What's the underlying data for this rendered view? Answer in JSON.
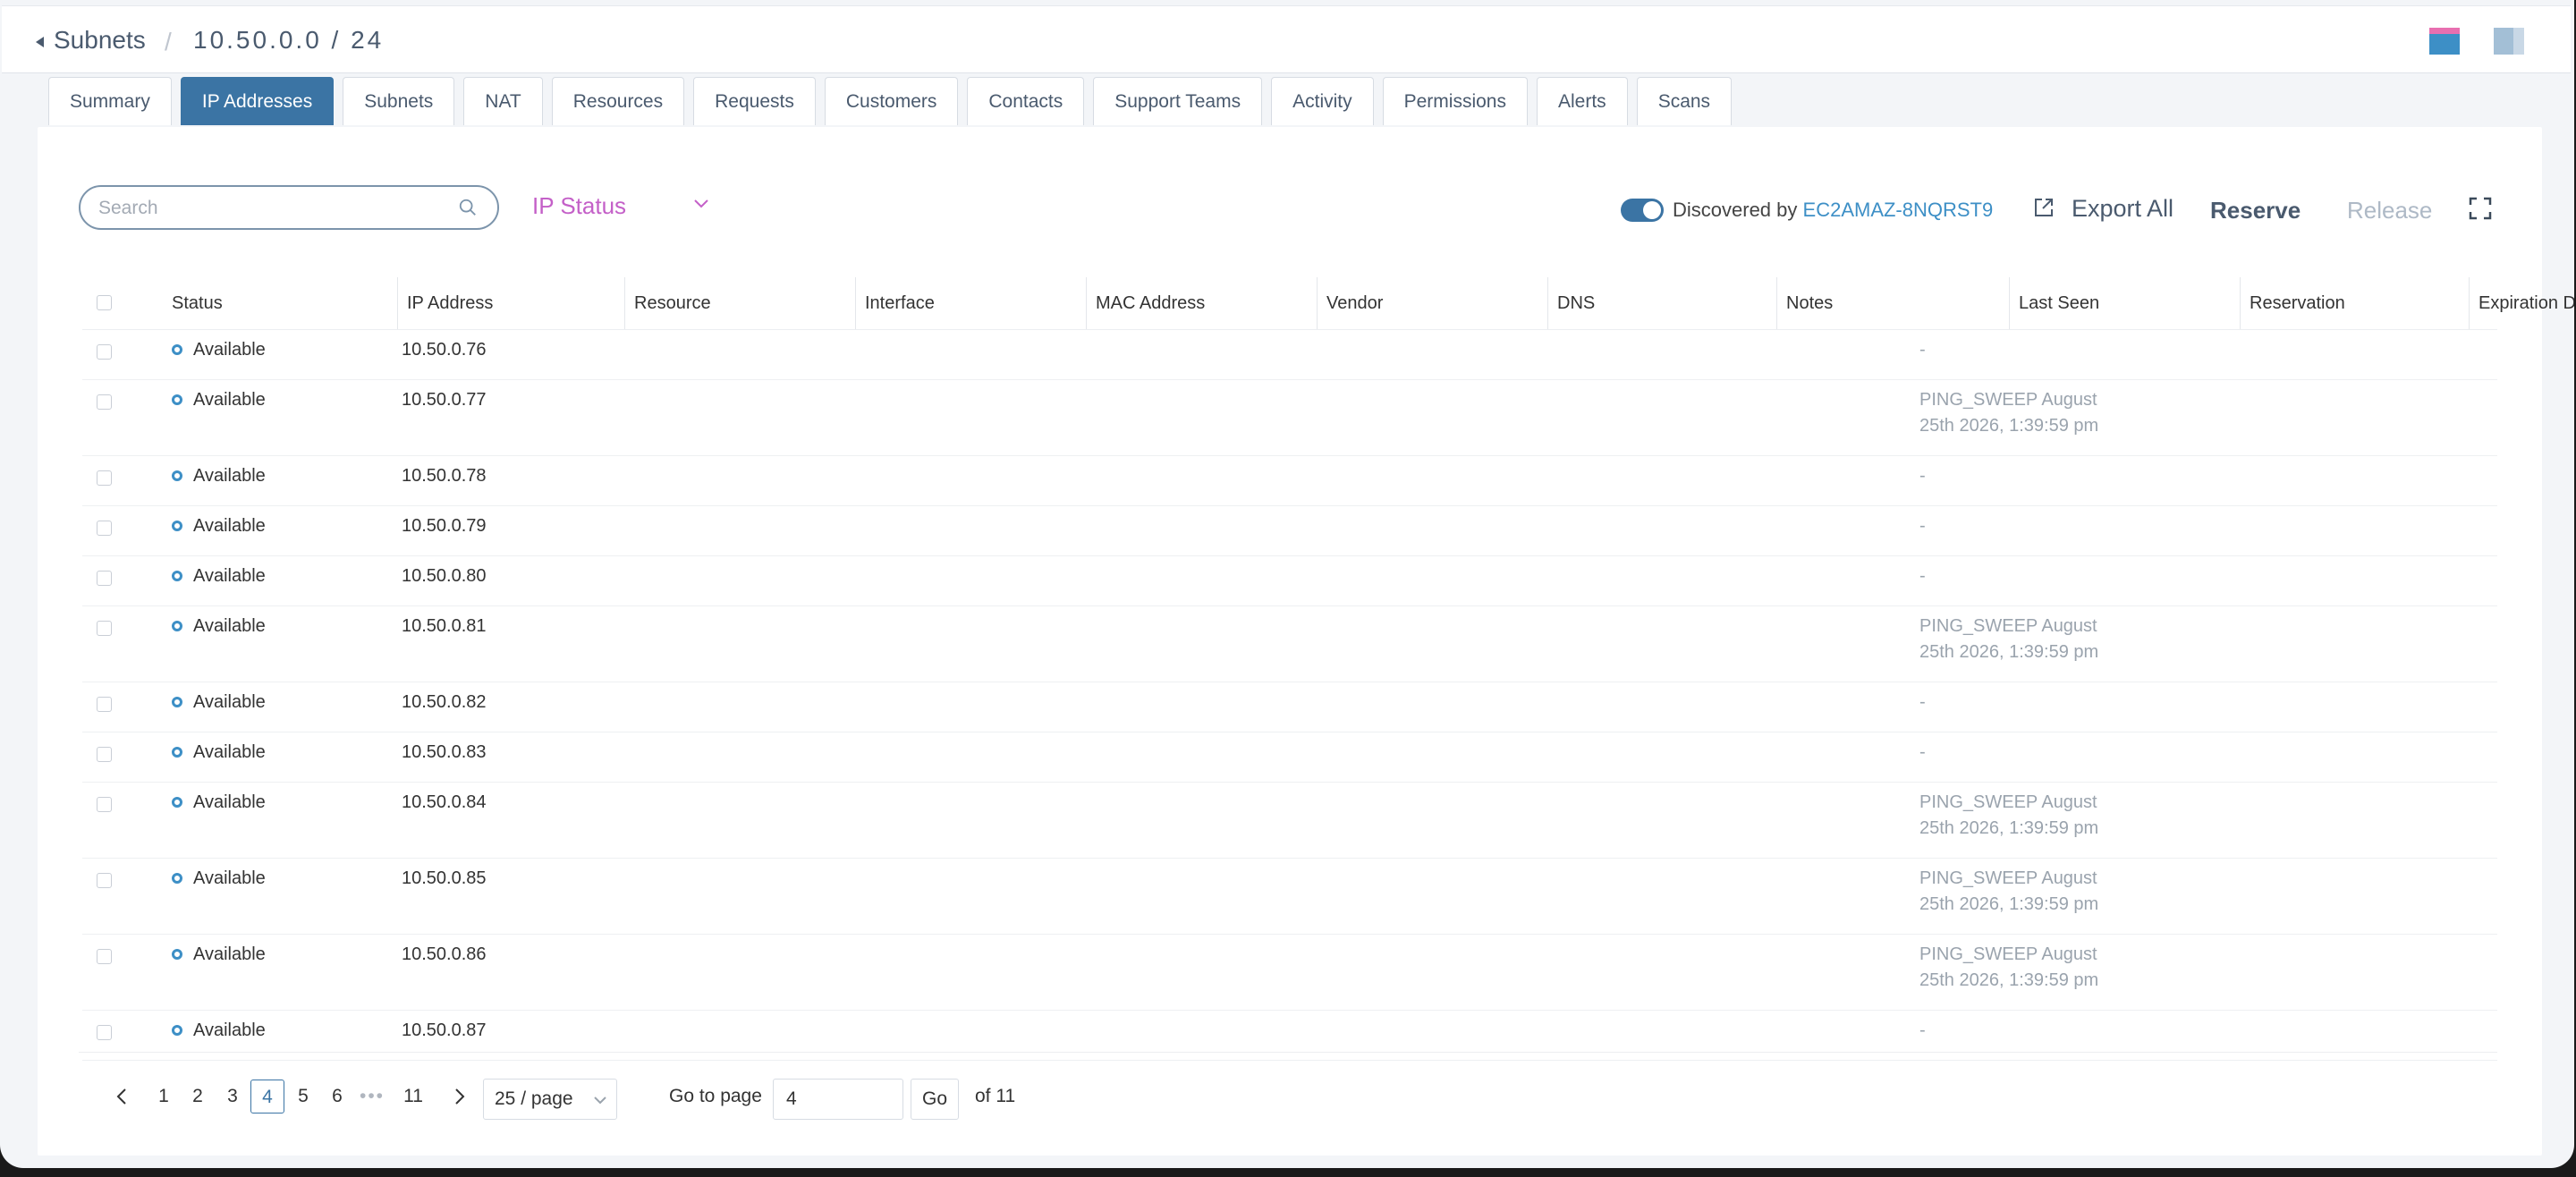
{
  "breadcrumb": {
    "parent": "Subnets",
    "separator": "/",
    "current": "10.50.0.0 / 24"
  },
  "tabs": [
    {
      "label": "Summary",
      "active": false
    },
    {
      "label": "IP Addresses",
      "active": true
    },
    {
      "label": "Subnets",
      "active": false
    },
    {
      "label": "NAT",
      "active": false
    },
    {
      "label": "Resources",
      "active": false
    },
    {
      "label": "Requests",
      "active": false
    },
    {
      "label": "Customers",
      "active": false
    },
    {
      "label": "Contacts",
      "active": false
    },
    {
      "label": "Support Teams",
      "active": false
    },
    {
      "label": "Activity",
      "active": false
    },
    {
      "label": "Permissions",
      "active": false
    },
    {
      "label": "Alerts",
      "active": false
    },
    {
      "label": "Scans",
      "active": false
    }
  ],
  "toolbar": {
    "search_placeholder": "Search",
    "status_filter_label": "IP Status",
    "discovered_label": "Discovered by",
    "discovered_host": "EC2AMAZ-8NQRST9",
    "discovered_enabled": true,
    "export_label": "Export All",
    "reserve_label": "Reserve",
    "release_label": "Release"
  },
  "columns": [
    "Status",
    "IP Address",
    "Resource",
    "Interface",
    "MAC Address",
    "Vendor",
    "DNS",
    "Notes",
    "Last Seen",
    "Reservation",
    "Expiration Date"
  ],
  "rows": [
    {
      "status": "Available",
      "ip": "10.50.0.76",
      "last_seen_1": "-",
      "last_seen_2": ""
    },
    {
      "status": "Available",
      "ip": "10.50.0.77",
      "last_seen_1": "PING_SWEEP August",
      "last_seen_2": "25th 2026, 1:39:59 pm"
    },
    {
      "status": "Available",
      "ip": "10.50.0.78",
      "last_seen_1": "-",
      "last_seen_2": ""
    },
    {
      "status": "Available",
      "ip": "10.50.0.79",
      "last_seen_1": "-",
      "last_seen_2": ""
    },
    {
      "status": "Available",
      "ip": "10.50.0.80",
      "last_seen_1": "-",
      "last_seen_2": ""
    },
    {
      "status": "Available",
      "ip": "10.50.0.81",
      "last_seen_1": "PING_SWEEP August",
      "last_seen_2": "25th 2026, 1:39:59 pm"
    },
    {
      "status": "Available",
      "ip": "10.50.0.82",
      "last_seen_1": "-",
      "last_seen_2": ""
    },
    {
      "status": "Available",
      "ip": "10.50.0.83",
      "last_seen_1": "-",
      "last_seen_2": ""
    },
    {
      "status": "Available",
      "ip": "10.50.0.84",
      "last_seen_1": "PING_SWEEP August",
      "last_seen_2": "25th 2026, 1:39:59 pm"
    },
    {
      "status": "Available",
      "ip": "10.50.0.85",
      "last_seen_1": "PING_SWEEP August",
      "last_seen_2": "25th 2026, 1:39:59 pm"
    },
    {
      "status": "Available",
      "ip": "10.50.0.86",
      "last_seen_1": "PING_SWEEP August",
      "last_seen_2": "25th 2026, 1:39:59 pm"
    },
    {
      "status": "Available",
      "ip": "10.50.0.87",
      "last_seen_1": "-",
      "last_seen_2": ""
    }
  ],
  "pagination": {
    "pages": [
      "1",
      "2",
      "3",
      "4",
      "5",
      "6"
    ],
    "current": "4",
    "ellipsis": "•••",
    "last": "11",
    "page_size": "25 / page",
    "goto_label": "Go to page",
    "goto_value": "4",
    "go_label": "Go",
    "of_label": "of 11"
  },
  "colors": {
    "accent": "#3b74a4",
    "link": "#3d8fc6",
    "filter": "#c460c8",
    "muted": "#9aa3ad"
  }
}
